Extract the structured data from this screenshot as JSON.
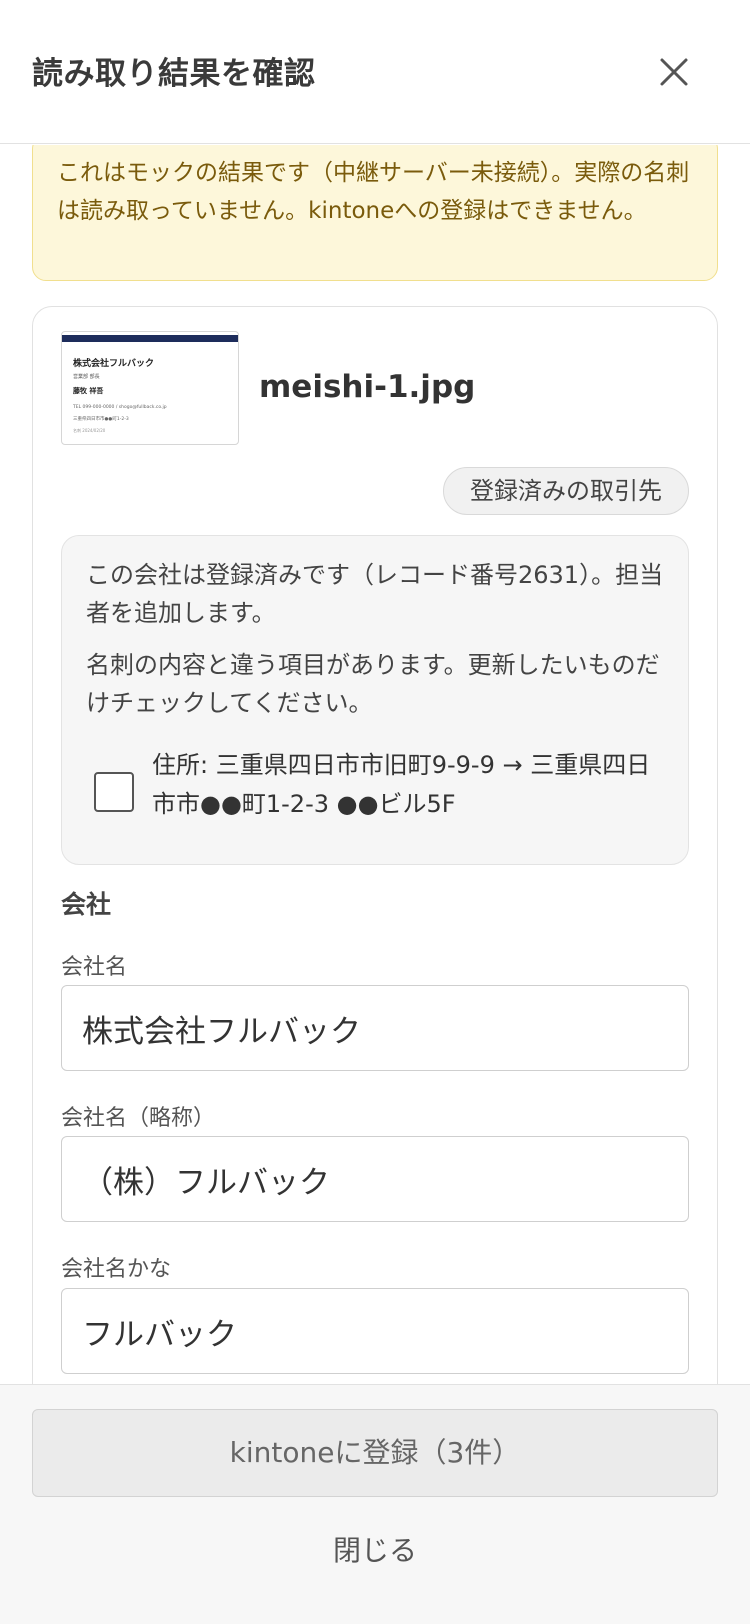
{
  "header": {
    "title": "読み取り結果を確認",
    "close_icon": "close-icon"
  },
  "notice": {
    "text": "これはモックの結果です（中継サーバー未接続）。実際の名刺は読み取っていません。kintoneへの登録はできません。"
  },
  "card": {
    "thumbnail": {
      "company": "株式会社フルバック",
      "dept": "営業部 部長",
      "name": "藤牧 祥吾",
      "tel": "TEL 099-000-0000 / shogo@fullback.co.jp",
      "address": "三重県四日市市●●町1-2-3",
      "date": "名刺 2024/02/20"
    },
    "filename": "meishi-1.jpg",
    "badge": "登録済みの取引先",
    "info": {
      "line1": "この会社は登録済みです（レコード番号2631）。担当者を追加します。",
      "line2": "名刺の内容と違う項目があります。更新したいものだけチェックしてください。"
    },
    "update_item": {
      "checked": false,
      "label": "住所: 三重県四日市市旧町9-9-9 → 三重県四日市市●●町1-2-3 ●●ビル5F"
    },
    "section": "会社",
    "fields": [
      {
        "label": "会社名",
        "value": "株式会社フルバック"
      },
      {
        "label": "会社名（略称）",
        "value": "（株）フルバック"
      },
      {
        "label": "会社名かな",
        "value": "フルバック"
      }
    ]
  },
  "footer": {
    "submit_label": "kintoneに登録（3件）",
    "close_label": "閉じる"
  },
  "colors": {
    "notice_bg": "#fdf7da",
    "notice_text": "#7a5b0c",
    "thumb_bar": "#1d2c5b"
  }
}
